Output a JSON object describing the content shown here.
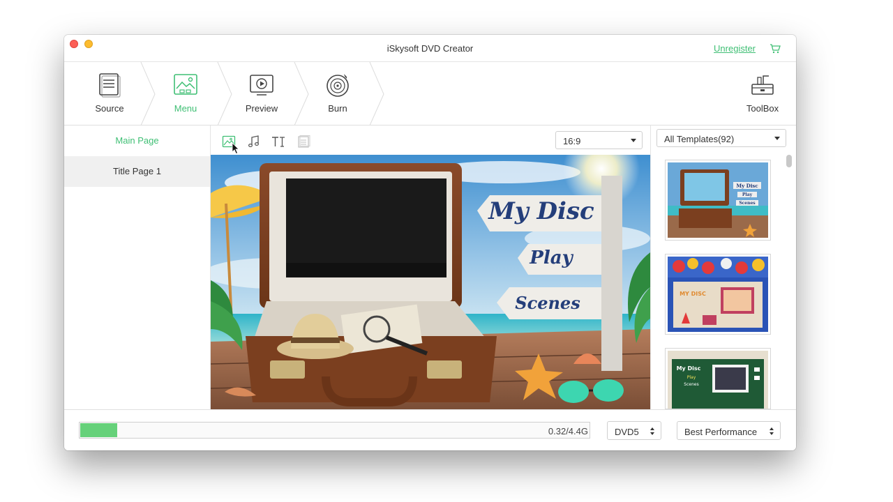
{
  "window": {
    "title": "iSkysoft DVD Creator",
    "unregister_label": "Unregister"
  },
  "toolbar": {
    "steps": [
      {
        "label": "Source",
        "icon": "source-icon"
      },
      {
        "label": "Menu",
        "icon": "menu-image-icon",
        "active": true
      },
      {
        "label": "Preview",
        "icon": "preview-play-icon"
      },
      {
        "label": "Burn",
        "icon": "burn-disc-icon"
      }
    ],
    "toolbox_label": "ToolBox"
  },
  "left_panel": {
    "main_page": "Main Page",
    "title_page": "Title Page  1"
  },
  "editor": {
    "tools": [
      "background-image-icon",
      "music-note-icon",
      "text-icon",
      "chapters-icon"
    ],
    "aspect_ratio": "16:9"
  },
  "preview": {
    "sign_title": "My Disc",
    "sign_play": "Play",
    "sign_scenes": "Scenes"
  },
  "templates": {
    "filter": "All Templates(92)",
    "thumb_texts": {
      "t1_title": "My Disc",
      "t1_play": "Play",
      "t1_scenes": "Scenes",
      "t2_title": "MY DISC",
      "t3_title": "My Disc",
      "t3_play": "Play",
      "t3_scenes": "Scenes"
    }
  },
  "bottom": {
    "size_text": "0.32/4.4G",
    "progress": 0.073,
    "disc_type": "DVD5",
    "quality": "Best Performance"
  },
  "colors": {
    "accent": "#3fbf74",
    "progress_fill": "#66d17a"
  }
}
